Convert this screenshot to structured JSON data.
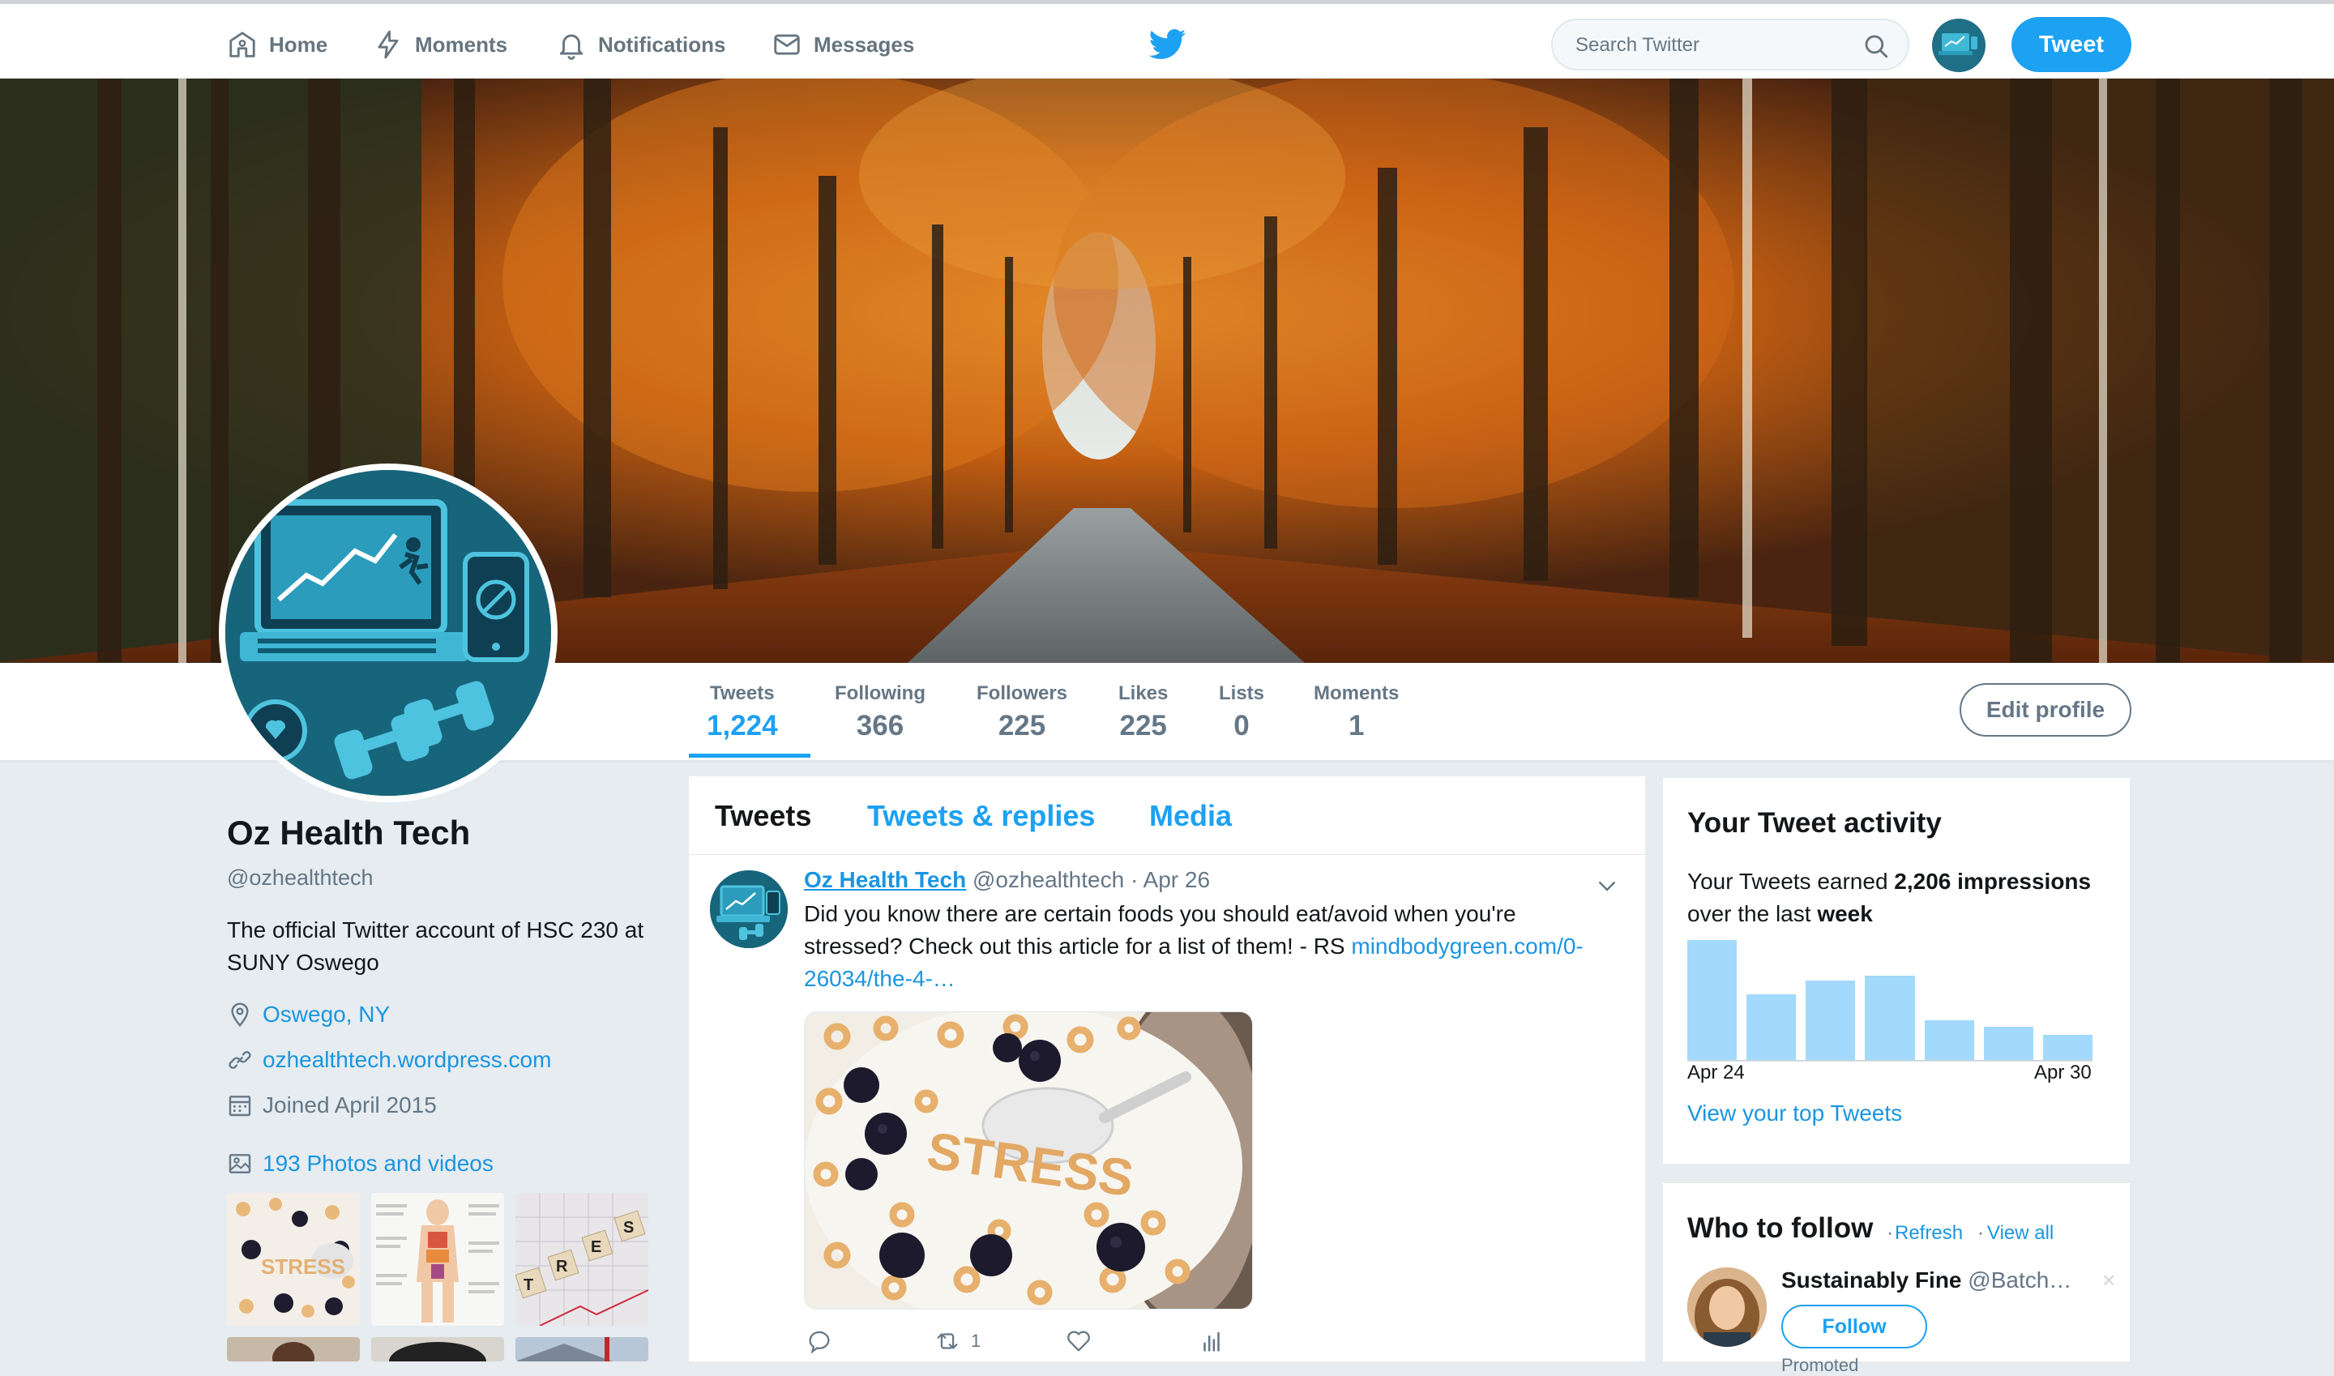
{
  "nav": {
    "home": "Home",
    "moments": "Moments",
    "notifications": "Notifications",
    "messages": "Messages",
    "search_placeholder": "Search Twitter",
    "tweet_button": "Tweet"
  },
  "profile_nav": {
    "stats": [
      {
        "label": "Tweets",
        "value": "1,224"
      },
      {
        "label": "Following",
        "value": "366"
      },
      {
        "label": "Followers",
        "value": "225"
      },
      {
        "label": "Likes",
        "value": "225"
      },
      {
        "label": "Lists",
        "value": "0"
      },
      {
        "label": "Moments",
        "value": "1"
      }
    ],
    "edit_profile": "Edit profile"
  },
  "profile": {
    "name": "Oz Health Tech",
    "handle": "@ozhealthtech",
    "bio": "The official Twitter account of HSC 230 at SUNY Oswego",
    "location": "Oswego, NY",
    "website": "ozhealthtech.wordpress.com",
    "joined": "Joined April 2015",
    "photos_videos": "193 Photos and videos"
  },
  "timeline": {
    "tabs": [
      "Tweets",
      "Tweets & replies",
      "Media"
    ],
    "tweet": {
      "name": "Oz Health Tech",
      "handle": "@ozhealthtech",
      "date": "Apr 26",
      "separator": "·",
      "text": "Did you know there are certain foods you should eat/avoid when you're stressed? Check out this article for a list of them! - RS ",
      "link": "mindbodygreen.com/0-26034/the-4-…",
      "retweets": "1"
    }
  },
  "activity": {
    "title": "Your Tweet activity",
    "text_pre": "Your Tweets earned ",
    "impressions": "2,206 impressions",
    "text_mid": " over the last ",
    "period": "week",
    "start_label": "Apr 24",
    "end_label": "Apr 30",
    "top_tweets_link": "View your top Tweets"
  },
  "chart_data": {
    "type": "bar",
    "categories": [
      "Apr 24",
      "Apr 25",
      "Apr 26",
      "Apr 27",
      "Apr 28",
      "Apr 29",
      "Apr 30"
    ],
    "values": [
      100,
      55,
      66,
      70,
      33,
      28,
      21
    ],
    "ylim": [
      0,
      100
    ],
    "color": "#a3d9fc"
  },
  "who_to_follow": {
    "title": "Who to follow",
    "refresh": "Refresh",
    "view_all": "View all",
    "dot": "·",
    "suggestion": {
      "name": "Sustainably Fine",
      "handle": "@Batch…",
      "follow": "Follow",
      "promoted": "Promoted"
    }
  },
  "colors": {
    "accent": "#1da1f2",
    "link": "#1b95e0",
    "background": "#e6ecf0"
  }
}
